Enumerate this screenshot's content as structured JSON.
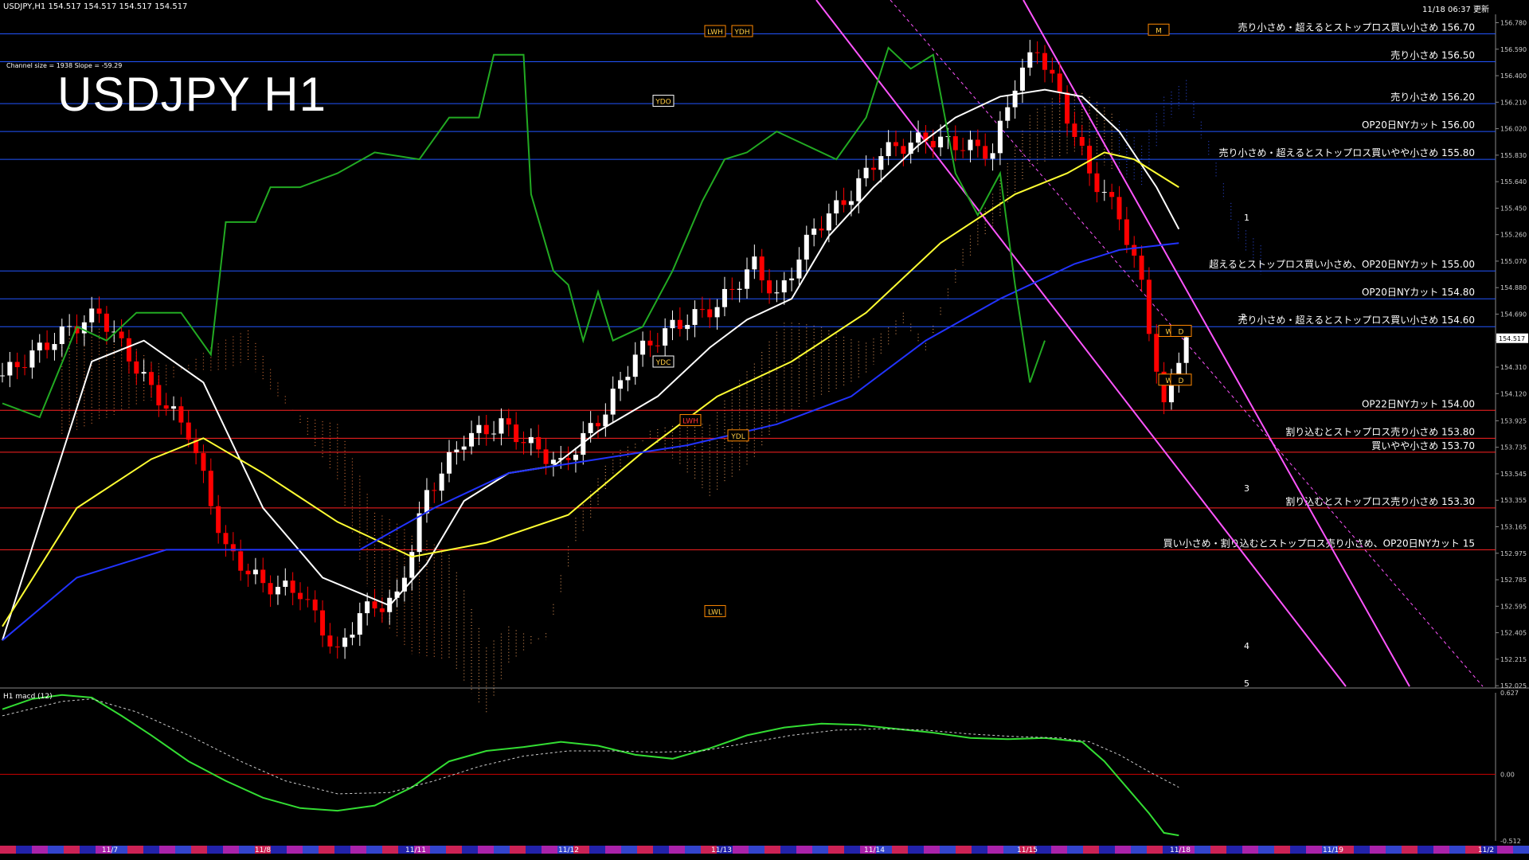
{
  "header": {
    "symbol_info": "USDJPY,H1  154.517 154.517 154.517 154.517",
    "timestamp": "11/18 06:37 更新",
    "channel_info": "Channel size = 1938 Slope = -59.29",
    "big_title": "USDJPY H1",
    "macd_label": "H1  macd (12)"
  },
  "colors": {
    "background": "#000000",
    "bull_candle": "#ffffff",
    "bear_candle": "#ff0000",
    "white_ma": "#ffffff",
    "yellow_ma": "#ffff33",
    "blue_ma": "#2233ff",
    "green_line": "#22aa22",
    "channel_pink": "#ff55ff",
    "level_blue": "#2255ff",
    "level_red": "#ff2222",
    "macd_green": "#33dd33",
    "macd_pink": "#ff88aa"
  },
  "chart_data": [
    {
      "type": "candlestick",
      "title": "USDJPY H1",
      "ylim": [
        152.02,
        156.84
      ],
      "y_ticks": [
        "156.780",
        "156.590",
        "156.400",
        "156.210",
        "156.020",
        "155.830",
        "155.640",
        "155.450",
        "155.260",
        "155.070",
        "154.880",
        "154.690",
        "154.500",
        "154.310",
        "154.120",
        "153.925",
        "153.735",
        "153.545",
        "153.355",
        "153.165",
        "152.975",
        "152.785",
        "152.595",
        "152.405",
        "152.215",
        "152.025"
      ],
      "current_price_label": "154.517",
      "x_labels": [
        "11/7",
        "11/8",
        "11/11",
        "11/12",
        "11/13",
        "11/14",
        "11/15",
        "11/18",
        "11/19",
        "11/2"
      ],
      "bars": 200,
      "key_prices": [
        {
          "x": 0,
          "price": 154.25
        },
        {
          "x": 8,
          "price": 154.55
        },
        {
          "x": 13,
          "price": 154.7
        },
        {
          "x": 20,
          "price": 154.15
        },
        {
          "x": 25,
          "price": 153.85
        },
        {
          "x": 30,
          "price": 153.0
        },
        {
          "x": 35,
          "price": 152.75
        },
        {
          "x": 40,
          "price": 152.7
        },
        {
          "x": 45,
          "price": 152.25
        },
        {
          "x": 48,
          "price": 152.55
        },
        {
          "x": 53,
          "price": 152.65
        },
        {
          "x": 57,
          "price": 153.4
        },
        {
          "x": 62,
          "price": 153.8
        },
        {
          "x": 67,
          "price": 153.9
        },
        {
          "x": 71,
          "price": 153.75
        },
        {
          "x": 75,
          "price": 153.6
        },
        {
          "x": 81,
          "price": 154.0
        },
        {
          "x": 85,
          "price": 154.4
        },
        {
          "x": 90,
          "price": 154.6
        },
        {
          "x": 96,
          "price": 154.75
        },
        {
          "x": 101,
          "price": 155.05
        },
        {
          "x": 104,
          "price": 154.8
        },
        {
          "x": 109,
          "price": 155.3
        },
        {
          "x": 114,
          "price": 155.55
        },
        {
          "x": 118,
          "price": 155.85
        },
        {
          "x": 124,
          "price": 155.95
        },
        {
          "x": 129,
          "price": 155.9
        },
        {
          "x": 133,
          "price": 155.85
        },
        {
          "x": 136,
          "price": 156.35
        },
        {
          "x": 139,
          "price": 156.6
        },
        {
          "x": 142,
          "price": 156.25
        },
        {
          "x": 146,
          "price": 155.7
        },
        {
          "x": 150,
          "price": 155.4
        },
        {
          "x": 153,
          "price": 154.9
        },
        {
          "x": 156,
          "price": 154.0
        },
        {
          "x": 158,
          "price": 154.4
        },
        {
          "x": 159,
          "price": 154.517
        }
      ],
      "series": [
        {
          "name": "",
          "color": "#ffffff",
          "values": [
            [
              0,
              152.35
            ],
            [
              12,
              154.35
            ],
            [
              19,
              154.5
            ],
            [
              27,
              154.2
            ],
            [
              35,
              153.3
            ],
            [
              43,
              152.8
            ],
            [
              52,
              152.6
            ],
            [
              57,
              152.9
            ],
            [
              62,
              153.35
            ],
            [
              68,
              153.55
            ],
            [
              74,
              153.6
            ],
            [
              80,
              153.85
            ],
            [
              88,
              154.1
            ],
            [
              95,
              154.45
            ],
            [
              100,
              154.65
            ],
            [
              106,
              154.8
            ],
            [
              111,
              155.25
            ],
            [
              117,
              155.6
            ],
            [
              123,
              155.9
            ],
            [
              128,
              156.1
            ],
            [
              134,
              156.25
            ],
            [
              140,
              156.3
            ],
            [
              145,
              156.25
            ],
            [
              150,
              156.0
            ],
            [
              155,
              155.6
            ],
            [
              158,
              155.3
            ]
          ]
        },
        {
          "name": "",
          "color": "#ffff33",
          "values": [
            [
              0,
              152.45
            ],
            [
              10,
              153.3
            ],
            [
              20,
              153.65
            ],
            [
              27,
              153.8
            ],
            [
              35,
              153.55
            ],
            [
              45,
              153.2
            ],
            [
              55,
              152.95
            ],
            [
              65,
              153.05
            ],
            [
              76,
              153.25
            ],
            [
              86,
              153.7
            ],
            [
              96,
              154.1
            ],
            [
              106,
              154.35
            ],
            [
              116,
              154.7
            ],
            [
              126,
              155.2
            ],
            [
              136,
              155.55
            ],
            [
              143,
              155.7
            ],
            [
              148,
              155.85
            ],
            [
              152,
              155.8
            ],
            [
              158,
              155.6
            ]
          ]
        },
        {
          "name": "",
          "color": "#2233ff",
          "values": [
            [
              0,
              152.35
            ],
            [
              10,
              152.8
            ],
            [
              22,
              153.0
            ],
            [
              35,
              153.0
            ],
            [
              48,
              153.0
            ],
            [
              58,
              153.3
            ],
            [
              68,
              153.55
            ],
            [
              80,
              153.65
            ],
            [
              92,
              153.75
            ],
            [
              104,
              153.9
            ],
            [
              114,
              154.1
            ],
            [
              124,
              154.5
            ],
            [
              134,
              154.8
            ],
            [
              144,
              155.05
            ],
            [
              150,
              155.15
            ],
            [
              158,
              155.2
            ]
          ]
        },
        {
          "name": "",
          "color": "#22aa22",
          "values": [
            [
              0,
              154.05
            ],
            [
              5,
              153.95
            ],
            [
              10,
              154.6
            ],
            [
              14,
              154.5
            ],
            [
              18,
              154.7
            ],
            [
              24,
              154.7
            ],
            [
              28,
              154.4
            ],
            [
              30,
              155.35
            ],
            [
              34,
              155.35
            ],
            [
              36,
              155.6
            ],
            [
              40,
              155.6
            ],
            [
              45,
              155.7
            ],
            [
              50,
              155.85
            ],
            [
              56,
              155.8
            ],
            [
              60,
              156.1
            ],
            [
              64,
              156.1
            ],
            [
              66,
              156.55
            ],
            [
              70,
              156.55
            ],
            [
              71,
              155.55
            ],
            [
              74,
              155.0
            ],
            [
              76,
              154.9
            ],
            [
              78,
              154.5
            ],
            [
              80,
              154.85
            ],
            [
              82,
              154.5
            ],
            [
              86,
              154.6
            ],
            [
              90,
              155.0
            ],
            [
              94,
              155.5
            ],
            [
              97,
              155.8
            ],
            [
              100,
              155.85
            ],
            [
              104,
              156.0
            ],
            [
              108,
              155.9
            ],
            [
              112,
              155.8
            ],
            [
              116,
              156.1
            ],
            [
              119,
              156.6
            ],
            [
              122,
              156.45
            ],
            [
              125,
              156.55
            ],
            [
              128,
              155.7
            ],
            [
              131,
              155.4
            ],
            [
              134,
              155.7
            ],
            [
              136,
              154.9
            ],
            [
              138,
              154.2
            ],
            [
              140,
              154.5
            ]
          ]
        }
      ],
      "levels": [
        {
          "price": 156.7,
          "color": "#2255ff",
          "label": "売り小さめ・超えるとストップロス買い小さめ 156.70"
        },
        {
          "price": 156.5,
          "color": "#2255ff",
          "label": "売り小さめ 156.50"
        },
        {
          "price": 156.2,
          "color": "#2255ff",
          "label": "売り小さめ 156.20"
        },
        {
          "price": 156.0,
          "color": "#2255ff",
          "label": "OP20日NYカット 156.00"
        },
        {
          "price": 155.8,
          "color": "#2255ff",
          "label": "売り小さめ・超えるとストップロス買いやや小さめ 155.80"
        },
        {
          "price": 155.0,
          "color": "#2255ff",
          "label": "超えるとストップロス買い小さめ、OP20日NYカット 155.00"
        },
        {
          "price": 154.8,
          "color": "#2255ff",
          "label": "OP20日NYカット 154.80"
        },
        {
          "price": 154.6,
          "color": "#2255ff",
          "label": "売り小さめ・超えるとストップロス買い小さめ 154.60"
        },
        {
          "price": 154.0,
          "color": "#ff2222",
          "label": "OP22日NYカット 154.00"
        },
        {
          "price": 153.8,
          "color": "#ff2222",
          "label": "割り込むとストップロス売り小さめ 153.80"
        },
        {
          "price": 153.7,
          "color": "#ff2222",
          "label": "買いやや小さめ 153.70"
        },
        {
          "price": 153.3,
          "color": "#ff2222",
          "label": "割り込むとストップロス売り小さめ 153.30"
        },
        {
          "price": 153.0,
          "color": "#ff2222",
          "label": "買い小さめ・割り込むとストップロス売り小さめ、OP20日NYカット 15"
        }
      ],
      "markers": [
        {
          "label": "LWH",
          "price": 156.72
        },
        {
          "label": "YDH",
          "price": 156.72
        },
        {
          "label": "YDO",
          "price": 156.22
        },
        {
          "label": "YDC",
          "price": 154.35
        },
        {
          "label": "LWH",
          "price": 153.93
        },
        {
          "label": "YDL",
          "price": 153.82
        },
        {
          "label": "LWL",
          "price": 152.56
        },
        {
          "label": "W",
          "price": 154.57
        },
        {
          "label": "D",
          "price": 154.57
        },
        {
          "label": "W",
          "price": 154.22
        },
        {
          "label": "D",
          "price": 154.22
        },
        {
          "label": "M",
          "price": 156.73
        }
      ],
      "projection_labels": [
        "1",
        "2",
        "3",
        "4",
        "5"
      ]
    },
    {
      "type": "line",
      "title": "H1  macd (12)",
      "ylim": [
        -0.512,
        0.627
      ],
      "y_ticks": [
        "0.627",
        "0.00",
        "-0.512"
      ],
      "x_labels": [
        "11/7",
        "11/8",
        "11/11",
        "11/12",
        "11/13",
        "11/14",
        "11/15",
        "11/18",
        "11/19",
        "11/2"
      ],
      "series": [
        {
          "name": "",
          "color": "#33dd33",
          "values": [
            [
              0,
              0.5
            ],
            [
              4,
              0.58
            ],
            [
              8,
              0.61
            ],
            [
              12,
              0.59
            ],
            [
              16,
              0.45
            ],
            [
              20,
              0.3
            ],
            [
              25,
              0.1
            ],
            [
              30,
              -0.05
            ],
            [
              35,
              -0.18
            ],
            [
              40,
              -0.26
            ],
            [
              45,
              -0.28
            ],
            [
              50,
              -0.24
            ],
            [
              55,
              -0.1
            ],
            [
              60,
              0.1
            ],
            [
              65,
              0.18
            ],
            [
              70,
              0.21
            ],
            [
              75,
              0.25
            ],
            [
              80,
              0.22
            ],
            [
              85,
              0.15
            ],
            [
              90,
              0.12
            ],
            [
              95,
              0.2
            ],
            [
              100,
              0.3
            ],
            [
              105,
              0.36
            ],
            [
              110,
              0.39
            ],
            [
              115,
              0.38
            ],
            [
              120,
              0.35
            ],
            [
              125,
              0.32
            ],
            [
              130,
              0.28
            ],
            [
              135,
              0.27
            ],
            [
              140,
              0.28
            ],
            [
              145,
              0.25
            ],
            [
              148,
              0.1
            ],
            [
              151,
              -0.1
            ],
            [
              154,
              -0.3
            ],
            [
              156,
              -0.45
            ],
            [
              158,
              -0.47
            ]
          ]
        },
        {
          "name": "",
          "color": "#cccccc",
          "values": [
            [
              0,
              0.45
            ],
            [
              8,
              0.56
            ],
            [
              12,
              0.58
            ],
            [
              18,
              0.48
            ],
            [
              25,
              0.3
            ],
            [
              32,
              0.1
            ],
            [
              38,
              -0.05
            ],
            [
              45,
              -0.15
            ],
            [
              52,
              -0.14
            ],
            [
              58,
              -0.05
            ],
            [
              64,
              0.06
            ],
            [
              70,
              0.14
            ],
            [
              76,
              0.18
            ],
            [
              82,
              0.18
            ],
            [
              88,
              0.17
            ],
            [
              94,
              0.18
            ],
            [
              100,
              0.24
            ],
            [
              106,
              0.3
            ],
            [
              112,
              0.34
            ],
            [
              118,
              0.35
            ],
            [
              124,
              0.34
            ],
            [
              130,
              0.31
            ],
            [
              136,
              0.29
            ],
            [
              142,
              0.28
            ],
            [
              146,
              0.25
            ],
            [
              150,
              0.15
            ],
            [
              154,
              0.02
            ],
            [
              158,
              -0.1
            ]
          ]
        }
      ]
    }
  ]
}
